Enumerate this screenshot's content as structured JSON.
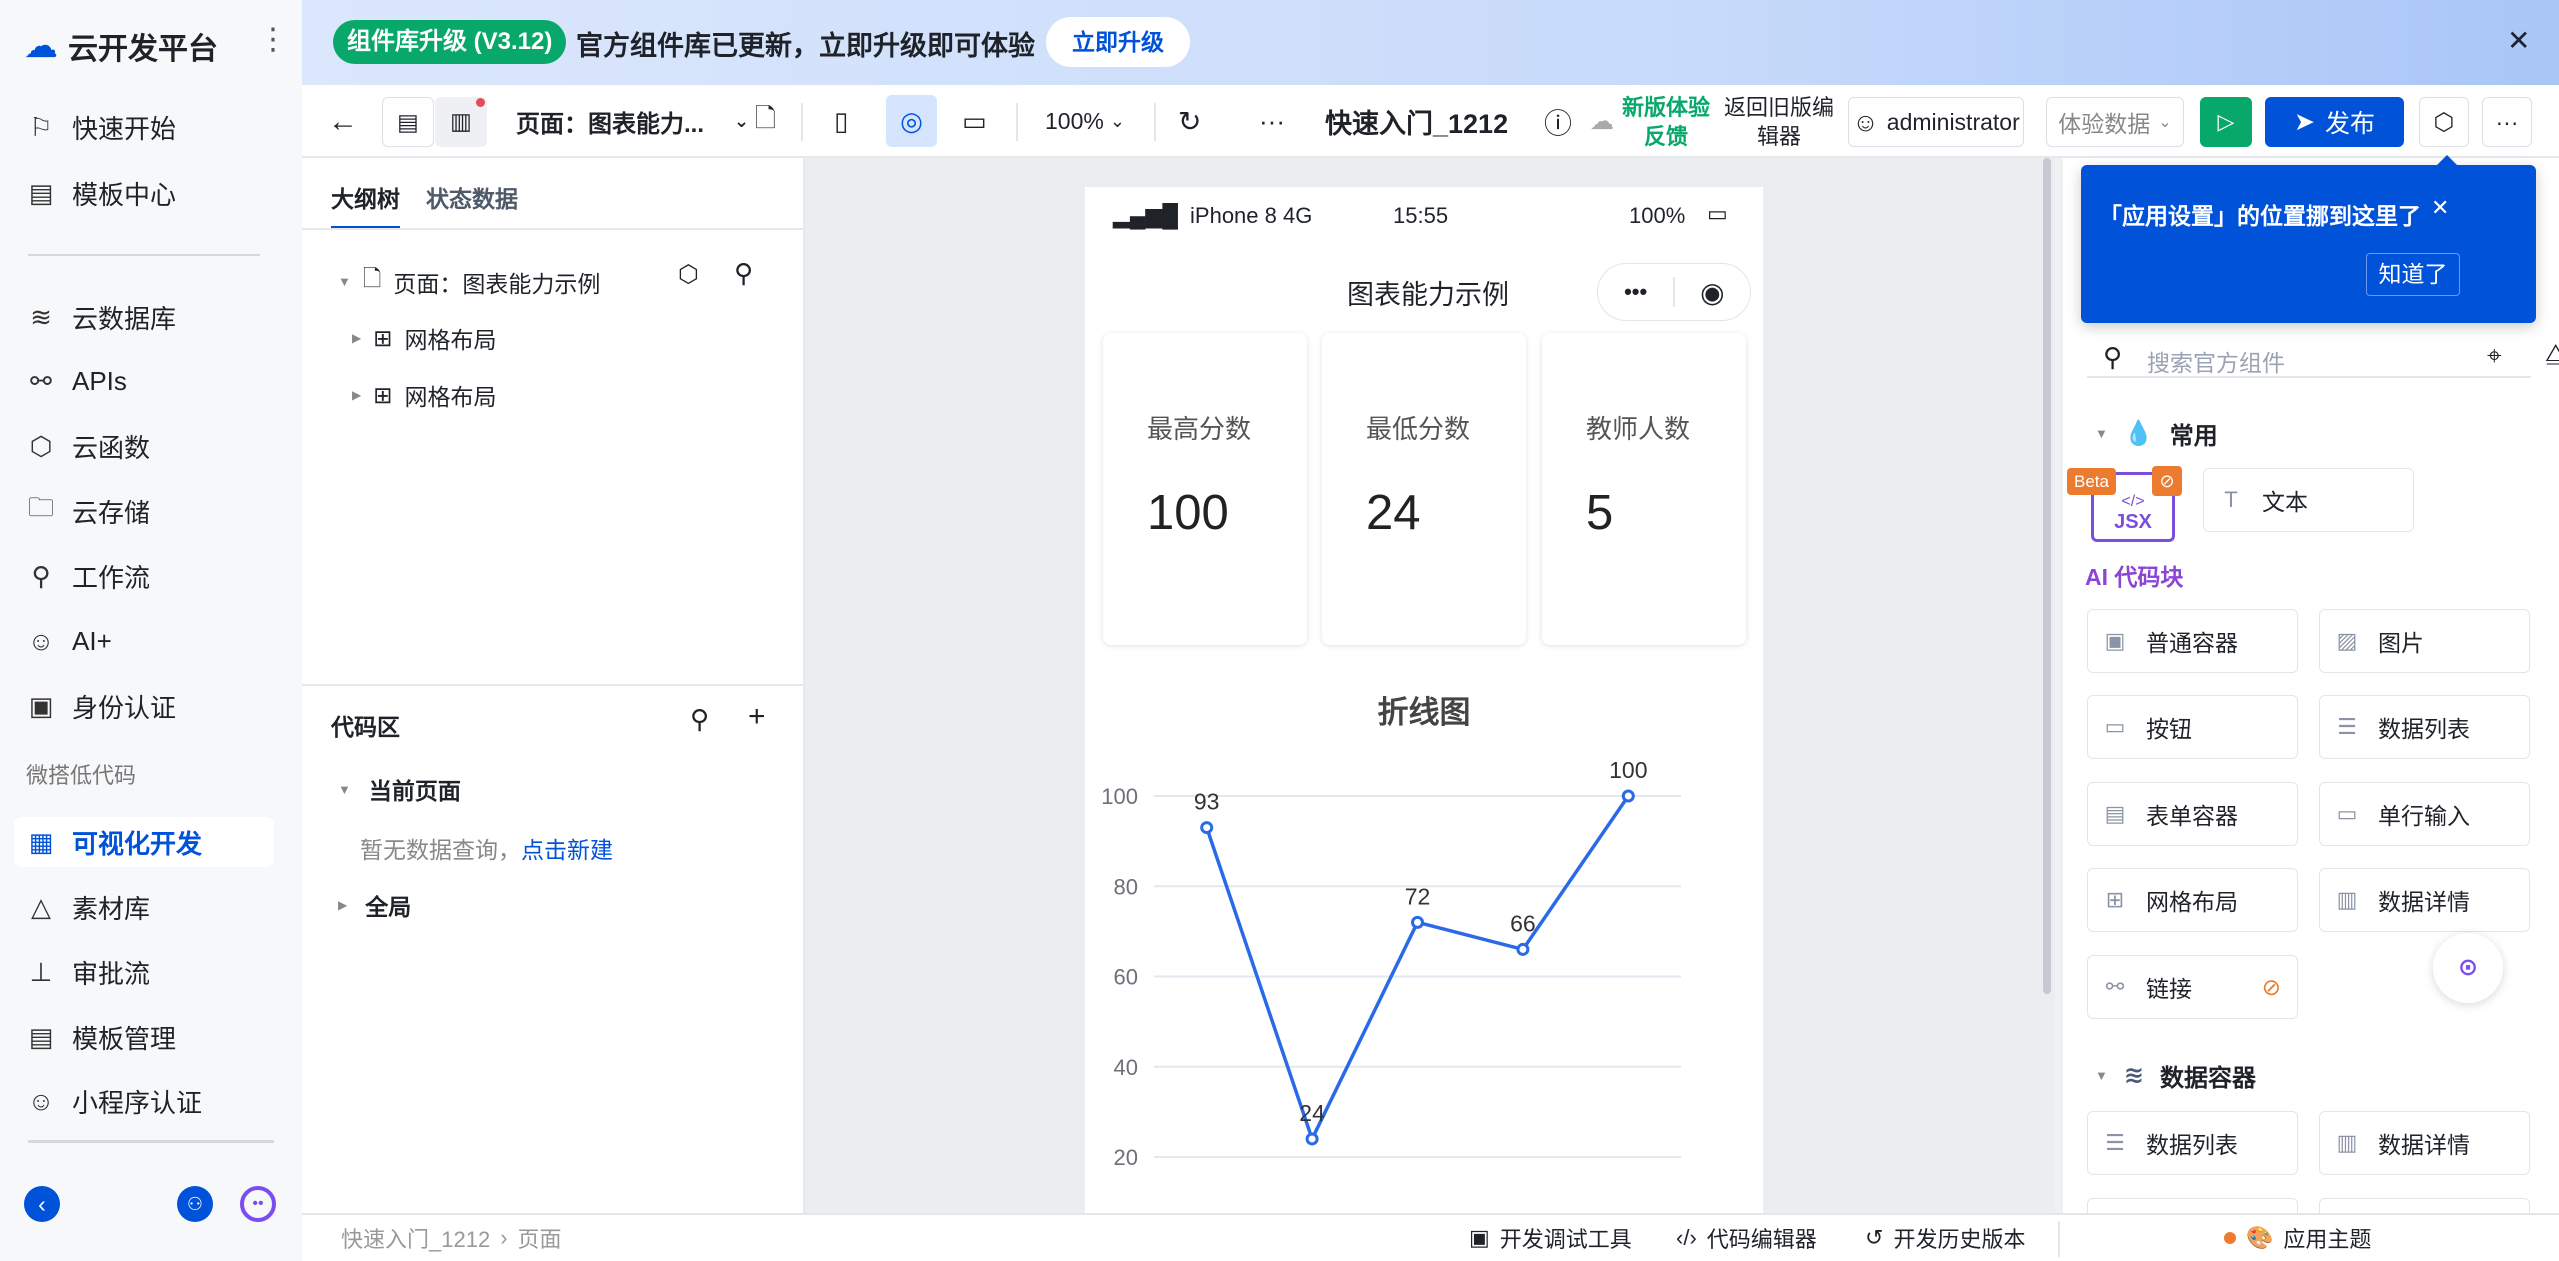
{
  "sidebar": {
    "brand": "云开发平台",
    "items": [
      {
        "label": "快速开始",
        "icon": "flag-icon"
      },
      {
        "label": "模板中心",
        "icon": "template-icon"
      },
      {
        "label": "云数据库",
        "icon": "database-icon"
      },
      {
        "label": "APIs",
        "icon": "link-icon"
      },
      {
        "label": "云函数",
        "icon": "function-icon"
      },
      {
        "label": "云存储",
        "icon": "folder-icon"
      },
      {
        "label": "工作流",
        "icon": "workflow-icon"
      },
      {
        "label": "AI+",
        "icon": "robot-icon"
      },
      {
        "label": "身份认证",
        "icon": "id-card-icon"
      }
    ],
    "section": "微搭低代码",
    "low_code_items": [
      {
        "label": "可视化开发",
        "icon": "layout-icon",
        "active": true
      },
      {
        "label": "素材库",
        "icon": "shapes-icon"
      },
      {
        "label": "审批流",
        "icon": "stamp-icon"
      },
      {
        "label": "模板管理",
        "icon": "template-icon"
      },
      {
        "label": "小程序认证",
        "icon": "miniprogram-icon"
      }
    ]
  },
  "banner": {
    "badge": "组件库升级 (V3.12)",
    "text": "官方组件库已更新，立即升级即可体验",
    "button": "立即升级",
    "close": "✕"
  },
  "toolbar": {
    "page": "页面：图表能力...",
    "zoom": "100%",
    "app_name": "快速入门_1212",
    "feedback": "新版体验反馈",
    "old_editor": "返回旧版编辑器",
    "user": "administrator",
    "data_env": "体验数据",
    "publish": "发布"
  },
  "left_panel": {
    "tabs": [
      "大纲树",
      "状态数据"
    ],
    "tree": {
      "page": "页面：图表能力示例",
      "children": [
        "网格布局",
        "网格布局"
      ]
    },
    "code": {
      "title": "代码区",
      "current_page": "当前页面",
      "empty": "暂无数据查询，",
      "create_link": "点击新建",
      "global": "全局"
    }
  },
  "phone": {
    "carrier": "iPhone 8  4G",
    "time": "15:55",
    "battery": "100%",
    "title": "图表能力示例",
    "cards": [
      {
        "label": "最高分数",
        "value": "100"
      },
      {
        "label": "最低分数",
        "value": "24"
      },
      {
        "label": "教师人数",
        "value": "5"
      }
    ]
  },
  "chart_data": {
    "type": "line",
    "title": "折线图",
    "values": [
      93,
      24,
      72,
      66,
      100
    ],
    "yticks": [
      "100",
      "80",
      "60",
      "40",
      "20"
    ],
    "ylim": [
      20,
      100
    ],
    "grid": true,
    "color": "#2a6ae8"
  },
  "right_panel": {
    "tooltip": {
      "text": "「应用设置」的位置挪到这里了",
      "close": "✕",
      "ok": "知道了"
    },
    "search_placeholder": "搜索官方组件",
    "common": {
      "title": "常用",
      "jsx_badge": "Beta",
      "jsx_label": "JSX",
      "jsx_caption": "AI 代码块",
      "text_comp": "文本",
      "items": [
        "普通容器",
        "图片",
        "按钮",
        "数据列表",
        "表单容器",
        "单行输入",
        "网格布局",
        "数据详情",
        "链接"
      ]
    },
    "data_container": {
      "title": "数据容器",
      "items": [
        "数据列表",
        "数据详情"
      ]
    }
  },
  "bottom": {
    "breadcrumb": [
      "快速入门_1212",
      "页面"
    ],
    "tools": [
      "开发调试工具",
      "代码编辑器",
      "开发历史版本"
    ],
    "theme": "应用主题"
  }
}
